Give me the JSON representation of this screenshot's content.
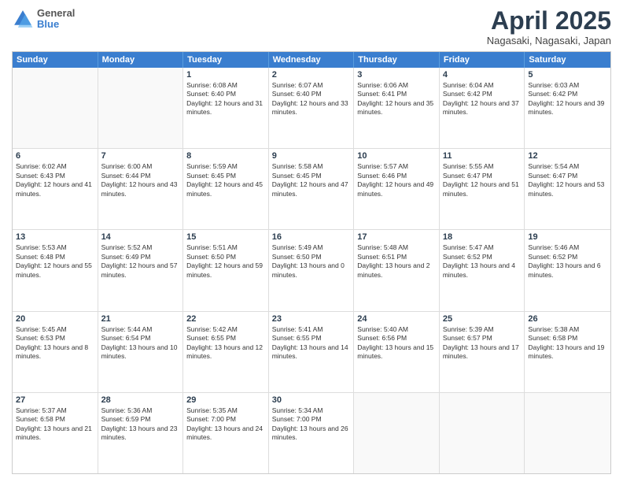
{
  "header": {
    "logo": {
      "line1": "General",
      "line2": "Blue"
    },
    "title": "April 2025",
    "location": "Nagasaki, Nagasaki, Japan"
  },
  "calendar": {
    "days": [
      "Sunday",
      "Monday",
      "Tuesday",
      "Wednesday",
      "Thursday",
      "Friday",
      "Saturday"
    ],
    "rows": [
      [
        {
          "day": "",
          "empty": true
        },
        {
          "day": "",
          "empty": true
        },
        {
          "day": "1",
          "sunrise": "Sunrise: 6:08 AM",
          "sunset": "Sunset: 6:40 PM",
          "daylight": "Daylight: 12 hours and 31 minutes."
        },
        {
          "day": "2",
          "sunrise": "Sunrise: 6:07 AM",
          "sunset": "Sunset: 6:40 PM",
          "daylight": "Daylight: 12 hours and 33 minutes."
        },
        {
          "day": "3",
          "sunrise": "Sunrise: 6:06 AM",
          "sunset": "Sunset: 6:41 PM",
          "daylight": "Daylight: 12 hours and 35 minutes."
        },
        {
          "day": "4",
          "sunrise": "Sunrise: 6:04 AM",
          "sunset": "Sunset: 6:42 PM",
          "daylight": "Daylight: 12 hours and 37 minutes."
        },
        {
          "day": "5",
          "sunrise": "Sunrise: 6:03 AM",
          "sunset": "Sunset: 6:42 PM",
          "daylight": "Daylight: 12 hours and 39 minutes."
        }
      ],
      [
        {
          "day": "6",
          "sunrise": "Sunrise: 6:02 AM",
          "sunset": "Sunset: 6:43 PM",
          "daylight": "Daylight: 12 hours and 41 minutes."
        },
        {
          "day": "7",
          "sunrise": "Sunrise: 6:00 AM",
          "sunset": "Sunset: 6:44 PM",
          "daylight": "Daylight: 12 hours and 43 minutes."
        },
        {
          "day": "8",
          "sunrise": "Sunrise: 5:59 AM",
          "sunset": "Sunset: 6:45 PM",
          "daylight": "Daylight: 12 hours and 45 minutes."
        },
        {
          "day": "9",
          "sunrise": "Sunrise: 5:58 AM",
          "sunset": "Sunset: 6:45 PM",
          "daylight": "Daylight: 12 hours and 47 minutes."
        },
        {
          "day": "10",
          "sunrise": "Sunrise: 5:57 AM",
          "sunset": "Sunset: 6:46 PM",
          "daylight": "Daylight: 12 hours and 49 minutes."
        },
        {
          "day": "11",
          "sunrise": "Sunrise: 5:55 AM",
          "sunset": "Sunset: 6:47 PM",
          "daylight": "Daylight: 12 hours and 51 minutes."
        },
        {
          "day": "12",
          "sunrise": "Sunrise: 5:54 AM",
          "sunset": "Sunset: 6:47 PM",
          "daylight": "Daylight: 12 hours and 53 minutes."
        }
      ],
      [
        {
          "day": "13",
          "sunrise": "Sunrise: 5:53 AM",
          "sunset": "Sunset: 6:48 PM",
          "daylight": "Daylight: 12 hours and 55 minutes."
        },
        {
          "day": "14",
          "sunrise": "Sunrise: 5:52 AM",
          "sunset": "Sunset: 6:49 PM",
          "daylight": "Daylight: 12 hours and 57 minutes."
        },
        {
          "day": "15",
          "sunrise": "Sunrise: 5:51 AM",
          "sunset": "Sunset: 6:50 PM",
          "daylight": "Daylight: 12 hours and 59 minutes."
        },
        {
          "day": "16",
          "sunrise": "Sunrise: 5:49 AM",
          "sunset": "Sunset: 6:50 PM",
          "daylight": "Daylight: 13 hours and 0 minutes."
        },
        {
          "day": "17",
          "sunrise": "Sunrise: 5:48 AM",
          "sunset": "Sunset: 6:51 PM",
          "daylight": "Daylight: 13 hours and 2 minutes."
        },
        {
          "day": "18",
          "sunrise": "Sunrise: 5:47 AM",
          "sunset": "Sunset: 6:52 PM",
          "daylight": "Daylight: 13 hours and 4 minutes."
        },
        {
          "day": "19",
          "sunrise": "Sunrise: 5:46 AM",
          "sunset": "Sunset: 6:52 PM",
          "daylight": "Daylight: 13 hours and 6 minutes."
        }
      ],
      [
        {
          "day": "20",
          "sunrise": "Sunrise: 5:45 AM",
          "sunset": "Sunset: 6:53 PM",
          "daylight": "Daylight: 13 hours and 8 minutes."
        },
        {
          "day": "21",
          "sunrise": "Sunrise: 5:44 AM",
          "sunset": "Sunset: 6:54 PM",
          "daylight": "Daylight: 13 hours and 10 minutes."
        },
        {
          "day": "22",
          "sunrise": "Sunrise: 5:42 AM",
          "sunset": "Sunset: 6:55 PM",
          "daylight": "Daylight: 13 hours and 12 minutes."
        },
        {
          "day": "23",
          "sunrise": "Sunrise: 5:41 AM",
          "sunset": "Sunset: 6:55 PM",
          "daylight": "Daylight: 13 hours and 14 minutes."
        },
        {
          "day": "24",
          "sunrise": "Sunrise: 5:40 AM",
          "sunset": "Sunset: 6:56 PM",
          "daylight": "Daylight: 13 hours and 15 minutes."
        },
        {
          "day": "25",
          "sunrise": "Sunrise: 5:39 AM",
          "sunset": "Sunset: 6:57 PM",
          "daylight": "Daylight: 13 hours and 17 minutes."
        },
        {
          "day": "26",
          "sunrise": "Sunrise: 5:38 AM",
          "sunset": "Sunset: 6:58 PM",
          "daylight": "Daylight: 13 hours and 19 minutes."
        }
      ],
      [
        {
          "day": "27",
          "sunrise": "Sunrise: 5:37 AM",
          "sunset": "Sunset: 6:58 PM",
          "daylight": "Daylight: 13 hours and 21 minutes."
        },
        {
          "day": "28",
          "sunrise": "Sunrise: 5:36 AM",
          "sunset": "Sunset: 6:59 PM",
          "daylight": "Daylight: 13 hours and 23 minutes."
        },
        {
          "day": "29",
          "sunrise": "Sunrise: 5:35 AM",
          "sunset": "Sunset: 7:00 PM",
          "daylight": "Daylight: 13 hours and 24 minutes."
        },
        {
          "day": "30",
          "sunrise": "Sunrise: 5:34 AM",
          "sunset": "Sunset: 7:00 PM",
          "daylight": "Daylight: 13 hours and 26 minutes."
        },
        {
          "day": "",
          "empty": true
        },
        {
          "day": "",
          "empty": true
        },
        {
          "day": "",
          "empty": true
        }
      ]
    ]
  }
}
